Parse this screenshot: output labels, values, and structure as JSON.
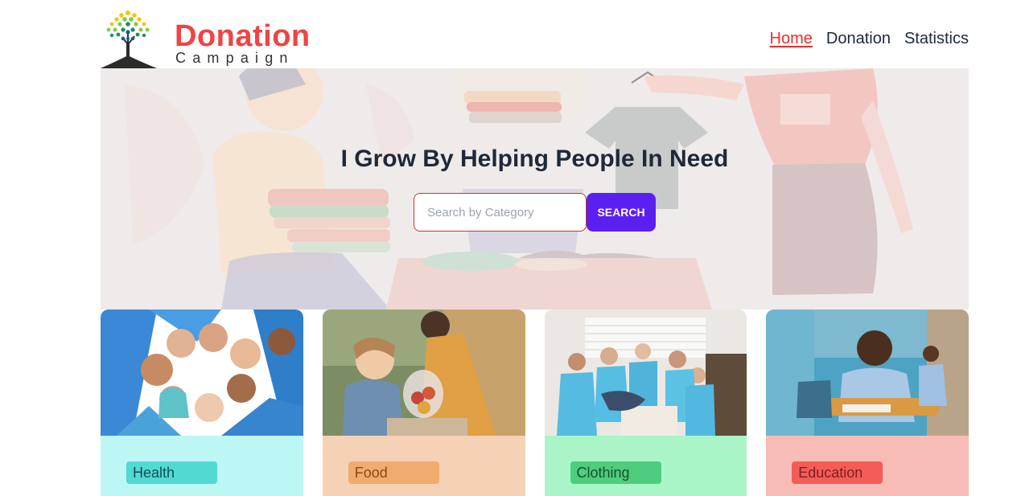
{
  "brand": {
    "title": "Donation",
    "subtitle": "Campaign"
  },
  "nav": {
    "items": [
      {
        "label": "Home",
        "active": true
      },
      {
        "label": "Donation",
        "active": false
      },
      {
        "label": "Statistics",
        "active": false
      }
    ]
  },
  "hero": {
    "title": "I Grow By Helping People In Need",
    "search_placeholder": "Search by Category",
    "search_button": "SEARCH"
  },
  "cards": [
    {
      "category": "Health",
      "image": "group-huddle-photo",
      "bg": "#bcf7f6",
      "tag_bg": "#52d9d2",
      "text_color": "#0f4f55"
    },
    {
      "category": "Food",
      "image": "girl-receiving-food-photo",
      "bg": "#f5d1b5",
      "tag_bg": "#f0ac6e",
      "text_color": "#8a4b11"
    },
    {
      "category": "Clothing",
      "image": "volunteers-sorting-clothes-photo",
      "bg": "#a9f5c8",
      "tag_bg": "#4fcc7e",
      "text_color": "#14532d"
    },
    {
      "category": "Education",
      "image": "student-at-desk-photo",
      "bg": "#f8bcb6",
      "tag_bg": "#f35d58",
      "text_color": "#7f1d1d"
    }
  ],
  "colors": {
    "accent": "#ef4444",
    "button": "#5b1ff2",
    "hero_bg": "#efebeb"
  }
}
